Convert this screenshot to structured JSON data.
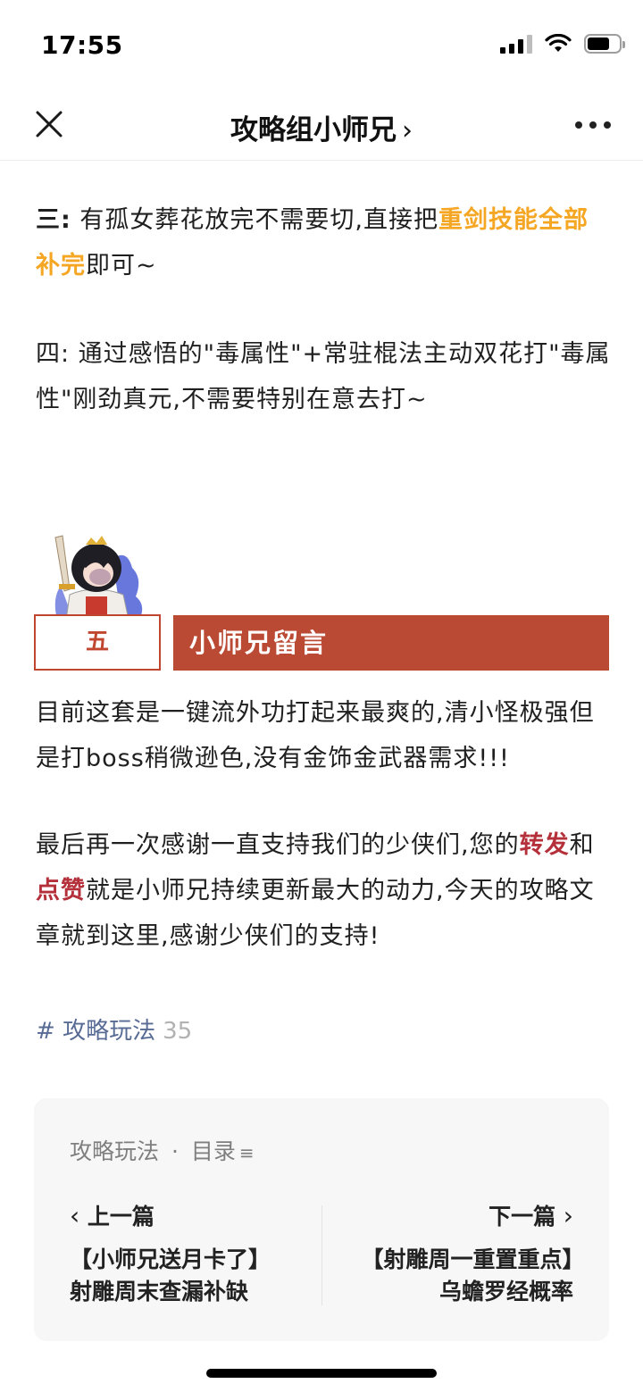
{
  "status_bar": {
    "time": "17:55",
    "battery_level": 0.72
  },
  "nav": {
    "title": "攻略组小师兄",
    "title_chevron": "›",
    "close_icon": "close-icon",
    "more_icon": "more-icon"
  },
  "article": {
    "para3": {
      "prefix": "三:",
      "text1": " 有孤女葬花放完不需要切,直接把",
      "highlight": "重剑技能全部补完",
      "text2": "即可~"
    },
    "para4": {
      "text": "四: 通过感悟的\"毒属性\"+常驻棍法主动双花打\"毒属性\"刚劲真元,不需要特别在意去打~"
    },
    "section": {
      "number": "五",
      "title": "小师兄留言"
    },
    "para5": {
      "text": "目前这套是一键流外功打起来最爽的,清小怪极强但是打boss稍微逊色,没有金饰金武器需求!!!"
    },
    "para6": {
      "text1": "最后再一次感谢一直支持我们的少侠们,您的",
      "hl1": "转发",
      "text2": "和",
      "hl2": "点赞",
      "text3": "就是小师兄持续更新最大的动力,今天的攻略文章就到这里,感谢少侠们的支持!"
    }
  },
  "tag": {
    "hash": "#",
    "name": "攻略玩法",
    "count": "35"
  },
  "album": {
    "name": "攻略玩法",
    "separator": "·",
    "directory": "目录",
    "list_glyph": "≡",
    "prev": {
      "label": "上一篇",
      "chevron": "‹",
      "title": "【小师兄送月卡了】射雕周末查漏补缺"
    },
    "next": {
      "label": "下一篇",
      "chevron": "›",
      "title": "【射雕周一重置重点】乌蟾罗经概率"
    }
  },
  "colors": {
    "accent_orange": "#f5a623",
    "accent_red": "#b4303a",
    "section_red": "#bb4a35",
    "tag_blue": "#576b95"
  }
}
